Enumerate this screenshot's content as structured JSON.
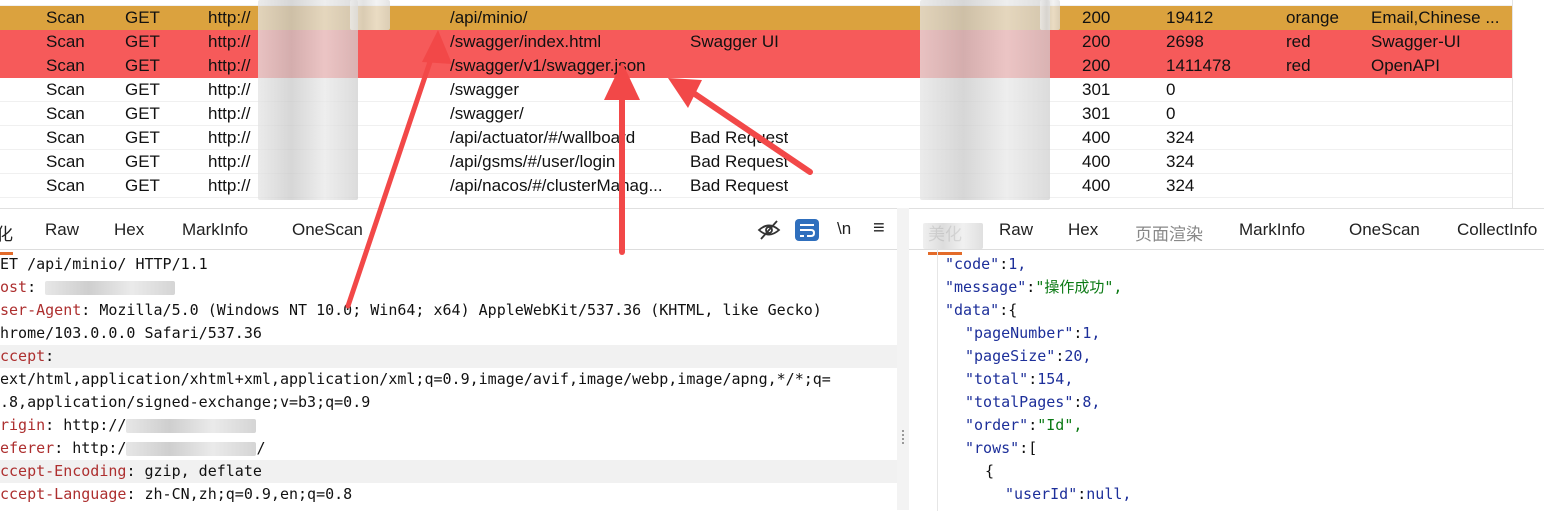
{
  "table": {
    "rows": [
      {
        "source": "Scan",
        "method": "GET",
        "url": "http://",
        "path": "/api/minio/",
        "title": "",
        "status": "200",
        "length": "19412",
        "color": "orange",
        "tags": "Email,Chinese ...",
        "style": "orange"
      },
      {
        "source": "Scan",
        "method": "GET",
        "url": "http://",
        "path": "/swagger/index.html",
        "title": "Swagger UI",
        "status": "200",
        "length": "2698",
        "color": "red",
        "tags": "Swagger-UI",
        "style": "red"
      },
      {
        "source": "Scan",
        "method": "GET",
        "url": "http://",
        "path": "/swagger/v1/swagger.json",
        "title": "",
        "status": "200",
        "length": "1411478",
        "color": "red",
        "tags": "OpenAPI",
        "style": "red"
      },
      {
        "source": "Scan",
        "method": "GET",
        "url": "http://",
        "path": "/swagger",
        "title": "",
        "status": "301",
        "length": "0",
        "color": "",
        "tags": "",
        "style": "plain"
      },
      {
        "source": "Scan",
        "method": "GET",
        "url": "http://",
        "path": "/swagger/",
        "title": "",
        "status": "301",
        "length": "0",
        "color": "",
        "tags": "",
        "style": "plain"
      },
      {
        "source": "Scan",
        "method": "GET",
        "url": "http://",
        "path": "/api/actuator/#/wallboard",
        "title": "Bad Request",
        "status": "400",
        "length": "324",
        "color": "",
        "tags": "",
        "style": "plain"
      },
      {
        "source": "Scan",
        "method": "GET",
        "url": "http://",
        "path": "/api/gsms/#/user/login",
        "title": "Bad Request",
        "status": "400",
        "length": "324",
        "color": "",
        "tags": "",
        "style": "plain"
      },
      {
        "source": "Scan",
        "method": "GET",
        "url": "http://",
        "path": "/api/nacos/#/clusterManag...",
        "title": "Bad Request",
        "status": "400",
        "length": "324",
        "color": "",
        "tags": "",
        "style": "plain"
      }
    ]
  },
  "request_panel": {
    "tabs": [
      "化",
      "Raw",
      "Hex",
      "MarkInfo",
      "OneScan"
    ],
    "tools": {
      "hide_label": "",
      "wrap_label": "",
      "newline_label": "\\n",
      "menu_label": "≡"
    },
    "lines": [
      {
        "key": "",
        "val": "ET /api/minio/ HTTP/1.1"
      },
      {
        "key": "ost",
        "val": ": "
      },
      {
        "key": "ser-Agent",
        "val": ": Mozilla/5.0 (Windows NT 10.0; Win64; x64) AppleWebKit/537.36 (KHTML, like Gecko)"
      },
      {
        "key": "",
        "val": "hrome/103.0.0.0 Safari/537.36"
      },
      {
        "key": "ccept",
        "val": ":"
      },
      {
        "key": "",
        "val": "ext/html,application/xhtml+xml,application/xml;q=0.9,image/avif,image/webp,image/apng,*/*;q="
      },
      {
        "key": "",
        "val": ".8,application/signed-exchange;v=b3;q=0.9"
      },
      {
        "key": "rigin",
        "val": ": http://"
      },
      {
        "key": "eferer",
        "val": ": http:/"
      },
      {
        "key": "ccept-Encoding",
        "val": ": gzip, deflate"
      },
      {
        "key": "ccept-Language",
        "val": ": zh-CN,zh;q=0.9,en;q=0.8"
      }
    ],
    "referer_tail": "/"
  },
  "response_panel": {
    "tabs": [
      "美化",
      "Raw",
      "Hex",
      "页面渲染",
      "MarkInfo",
      "OneScan",
      "CollectInfo"
    ],
    "json": [
      {
        "indent": 1,
        "key": "\"code\"",
        "sep": ":",
        "val": "1,",
        "type": "num"
      },
      {
        "indent": 1,
        "key": "\"message\"",
        "sep": ":",
        "val": "\"操作成功\",",
        "type": "str"
      },
      {
        "indent": 1,
        "key": "\"data\"",
        "sep": ":",
        "val": "{",
        "type": "punc"
      },
      {
        "indent": 2,
        "key": "\"pageNumber\"",
        "sep": ":",
        "val": "1,",
        "type": "num"
      },
      {
        "indent": 2,
        "key": "\"pageSize\"",
        "sep": ":",
        "val": "20,",
        "type": "num"
      },
      {
        "indent": 2,
        "key": "\"total\"",
        "sep": ":",
        "val": "154,",
        "type": "num"
      },
      {
        "indent": 2,
        "key": "\"totalPages\"",
        "sep": ":",
        "val": "8,",
        "type": "num"
      },
      {
        "indent": 2,
        "key": "\"order\"",
        "sep": ":",
        "val": "\"Id\",",
        "type": "str"
      },
      {
        "indent": 2,
        "key": "\"rows\"",
        "sep": ":",
        "val": "[",
        "type": "punc"
      },
      {
        "indent": 3,
        "key": "",
        "sep": "",
        "val": "{",
        "type": "punc"
      },
      {
        "indent": 4,
        "key": "\"userId\"",
        "sep": ":",
        "val": "null,",
        "type": "num"
      }
    ]
  },
  "colors": {
    "orange_row": "#dba23e",
    "red_row": "#f65a5a",
    "tab_active": "#e36b2a",
    "annotation_arrow": "#f24848",
    "wrap_icon": "#2f6fbd"
  }
}
